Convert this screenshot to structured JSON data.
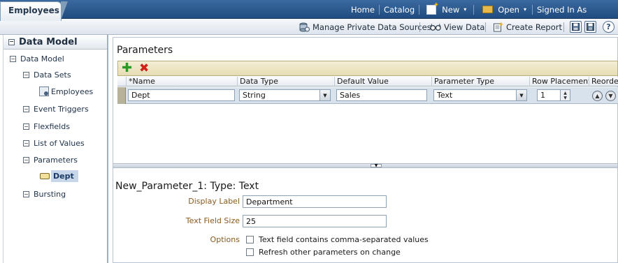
{
  "topbar": {
    "tab_label": "Employees",
    "home_label": "Home",
    "catalog_label": "Catalog",
    "new_label": "New",
    "open_label": "Open",
    "signed_in_label": "Signed In As"
  },
  "toolbar": {
    "manage_private_data_sources_label": "Manage Private Data Sources",
    "view_data_label": "View Data",
    "create_report_label": "Create Report"
  },
  "sidebar": {
    "header": "Data Model",
    "items": [
      {
        "label": "Data Model"
      },
      {
        "label": "Data Sets"
      },
      {
        "label": "Employees"
      },
      {
        "label": "Event Triggers"
      },
      {
        "label": "Flexfields"
      },
      {
        "label": "List of Values"
      },
      {
        "label": "Parameters"
      },
      {
        "label": "Dept"
      },
      {
        "label": "Bursting"
      }
    ]
  },
  "parameters": {
    "title": "Parameters",
    "columns": [
      {
        "label": "*Name"
      },
      {
        "label": "Data Type"
      },
      {
        "label": "Default Value"
      },
      {
        "label": "Parameter Type"
      },
      {
        "label": "Row Placement"
      },
      {
        "label": "Reorder"
      }
    ],
    "rows": [
      {
        "name": "Dept",
        "data_type": "String",
        "default_value": "Sales",
        "parameter_type": "Text",
        "row_placement": "1"
      }
    ]
  },
  "detail": {
    "title": "New_Parameter_1: Type: Text",
    "display_label_label": "Display Label",
    "display_label_value": "Department",
    "text_field_size_label": "Text Field Size",
    "text_field_size_value": "25",
    "options_label": "Options",
    "option_comma_label": "Text field contains comma-separated values",
    "option_refresh_label": "Refresh other parameters on change"
  },
  "colors": {
    "topbar": "#2b5a91",
    "grid_toolbar": "#ece4c3",
    "selected_row": "#d8e2ec",
    "form_label": "#8a5a1e"
  }
}
